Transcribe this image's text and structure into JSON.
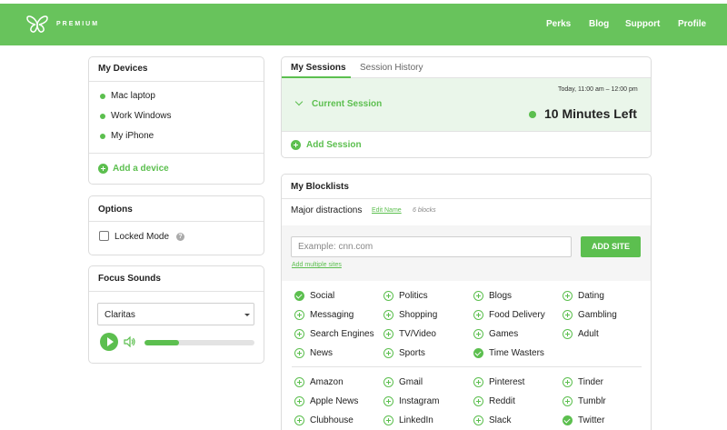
{
  "header": {
    "brand": "PREMIUM",
    "nav": [
      "Perks",
      "Blog",
      "Support",
      "Profile"
    ]
  },
  "devices": {
    "title": "My Devices",
    "items": [
      "Mac laptop",
      "Work Windows",
      "My iPhone"
    ],
    "add_label": "Add a device"
  },
  "options": {
    "title": "Options",
    "locked_mode_label": "Locked Mode",
    "locked_mode_checked": false,
    "help_glyph": "?"
  },
  "focus_sounds": {
    "title": "Focus Sounds",
    "selected": "Claritas",
    "volume_fraction": 0.31
  },
  "sessions": {
    "tabs": [
      "My Sessions",
      "Session History"
    ],
    "current_label": "Current Session",
    "time_range": "Today, 11:00 am – 12:00 pm",
    "time_left": "10 Minutes Left",
    "add_label": "Add Session"
  },
  "blocklists": {
    "title": "My Blocklists",
    "list_name": "Major distractions",
    "edit_label": "Edit Name",
    "count": "6 blocks",
    "input_placeholder": "Example: cnn.com",
    "add_site_label": "ADD SITE",
    "add_multiple_label": "Add multiple sites",
    "categories": [
      [
        {
          "label": "Social",
          "on": true
        },
        {
          "label": "Politics",
          "on": false
        },
        {
          "label": "Blogs",
          "on": false
        },
        {
          "label": "Dating",
          "on": false
        }
      ],
      [
        {
          "label": "Messaging",
          "on": false
        },
        {
          "label": "Shopping",
          "on": false
        },
        {
          "label": "Food Delivery",
          "on": false
        },
        {
          "label": "Gambling",
          "on": false
        }
      ],
      [
        {
          "label": "Search Engines",
          "on": false
        },
        {
          "label": "TV/Video",
          "on": false
        },
        {
          "label": "Games",
          "on": false
        },
        {
          "label": "Adult",
          "on": false
        }
      ],
      [
        {
          "label": "News",
          "on": false
        },
        {
          "label": "Sports",
          "on": false
        },
        {
          "label": "Time Wasters",
          "on": true
        },
        {
          "label": "",
          "on": false
        }
      ]
    ],
    "sites": [
      [
        {
          "label": "Amazon",
          "on": false
        },
        {
          "label": "Gmail",
          "on": false
        },
        {
          "label": "Pinterest",
          "on": false
        },
        {
          "label": "Tinder",
          "on": false
        }
      ],
      [
        {
          "label": "Apple News",
          "on": false
        },
        {
          "label": "Instagram",
          "on": false
        },
        {
          "label": "Reddit",
          "on": false
        },
        {
          "label": "Tumblr",
          "on": false
        }
      ],
      [
        {
          "label": "Clubhouse",
          "on": false
        },
        {
          "label": "LinkedIn",
          "on": false
        },
        {
          "label": "Slack",
          "on": false
        },
        {
          "label": "Twitter",
          "on": true
        }
      ]
    ]
  },
  "colors": {
    "brand_green": "#68c35c",
    "accent_green": "#5cbf4f",
    "session_bg": "#eaf6ea"
  }
}
